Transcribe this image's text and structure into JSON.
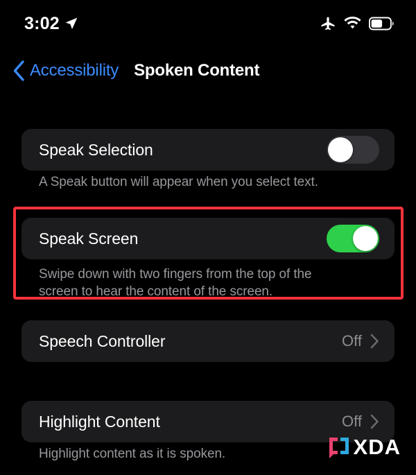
{
  "status_bar": {
    "time": "3:02",
    "icons": [
      "location-arrow-icon",
      "airplane-mode-icon",
      "wifi-icon",
      "battery-icon"
    ],
    "battery_level_percent": 55
  },
  "nav": {
    "back_label": "Accessibility",
    "back_icon": "chevron-left-icon",
    "title": "Spoken Content",
    "accent_color": "#3b8cff"
  },
  "rows": [
    {
      "label": "Speak Selection",
      "control": "toggle",
      "toggle_state": "off",
      "caption": "A Speak button will appear when you select text."
    },
    {
      "label": "Speak Screen",
      "control": "toggle",
      "toggle_state": "on",
      "caption": "Swipe down with two fingers from the top of the screen to hear the content of the screen."
    },
    {
      "label": "Speech Controller",
      "control": "disclosure",
      "value": "Off",
      "chevron_icon": "chevron-right-icon",
      "caption": ""
    },
    {
      "label": "Highlight Content",
      "control": "disclosure",
      "value": "Off",
      "chevron_icon": "chevron-right-icon",
      "caption": "Highlight content as it is spoken."
    }
  ],
  "annotation": {
    "color": "#f8333c",
    "target": "Speak Screen"
  },
  "watermark": {
    "text": "XDA",
    "bracket_left_color": "#e8416f",
    "bracket_right_color": "#2fa9e0"
  },
  "colors": {
    "background": "#000000",
    "card": "#1c1c1e",
    "toggle_on": "#2ed04b",
    "toggle_off": "#35353a",
    "secondary_text": "#98989d"
  }
}
